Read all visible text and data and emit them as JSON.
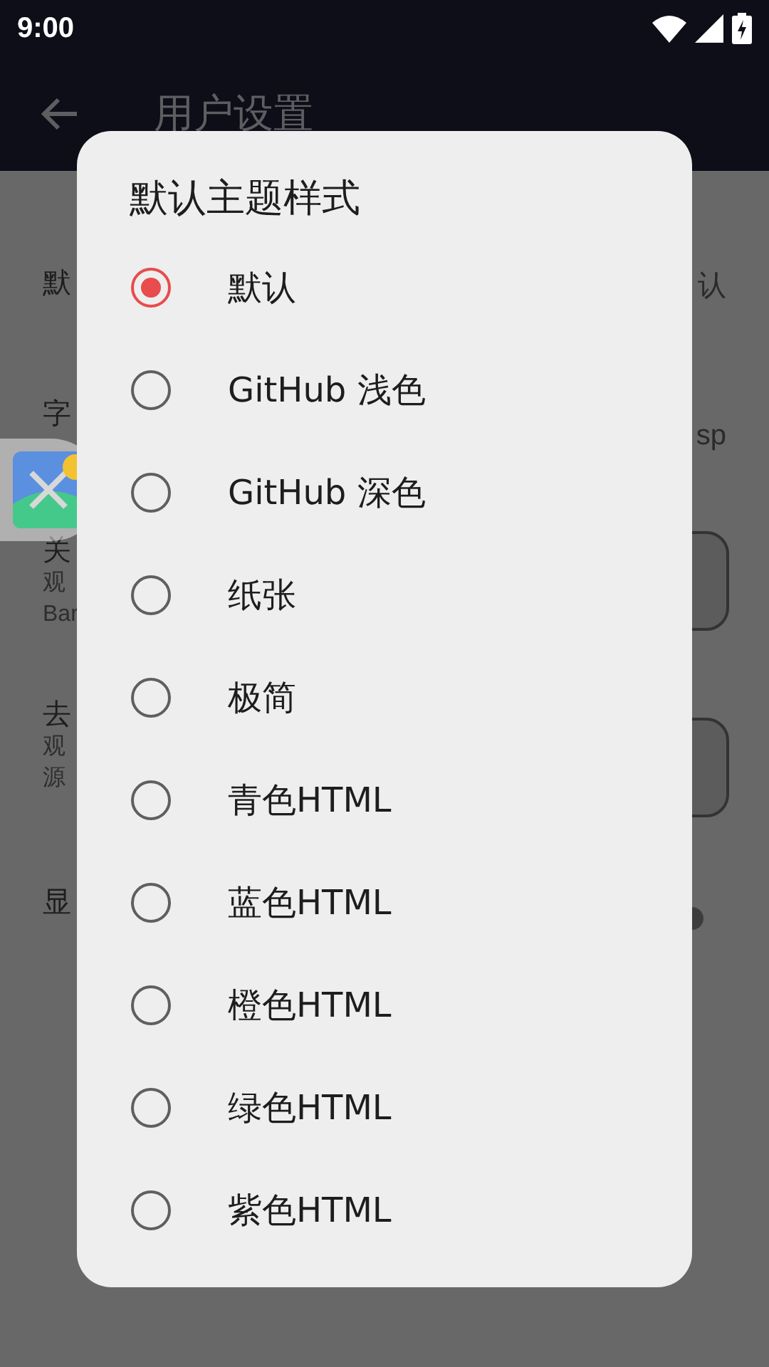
{
  "status_bar": {
    "time": "9:00"
  },
  "app_bar": {
    "title": "用户设置"
  },
  "settings": [
    {
      "kind": "value",
      "title": "默",
      "value": "认"
    },
    {
      "kind": "value",
      "title": "字",
      "value": "sp"
    },
    {
      "kind": "button",
      "title": "关",
      "subtitle": [
        "观",
        "Bar"
      ]
    },
    {
      "kind": "button",
      "title": "去",
      "subtitle": [
        "观",
        "源"
      ]
    },
    {
      "kind": "switch",
      "title": "显",
      "on": false
    }
  ],
  "dialog": {
    "title": "默认主题样式",
    "options": [
      {
        "label": "默认",
        "selected": true
      },
      {
        "label": "GitHub 浅色",
        "selected": false
      },
      {
        "label": "GitHub 深色",
        "selected": false
      },
      {
        "label": "纸张",
        "selected": false
      },
      {
        "label": "极简",
        "selected": false
      },
      {
        "label": "青色HTML",
        "selected": false
      },
      {
        "label": "蓝色HTML",
        "selected": false
      },
      {
        "label": "橙色HTML",
        "selected": false
      },
      {
        "label": "绿色HTML",
        "selected": false
      },
      {
        "label": "紫色HTML",
        "selected": false
      }
    ]
  }
}
